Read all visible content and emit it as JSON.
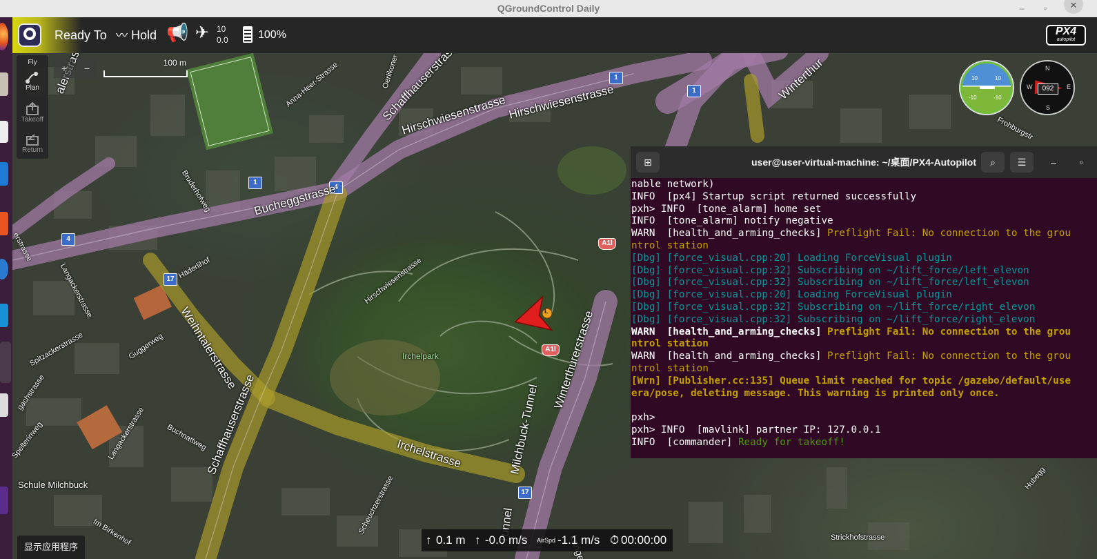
{
  "window": {
    "title": "QGroundControl Daily"
  },
  "toolbar": {
    "status": "Ready To",
    "flight_mode": "Hold",
    "gps_sats": "10",
    "gps_hdop": "0.0",
    "battery": "100%",
    "brand": "PX4",
    "brand_sub": "autopilot"
  },
  "flytools": {
    "fly": "Fly",
    "plan": "Plan",
    "takeoff": "Takeoff",
    "return": "Return"
  },
  "map": {
    "scale_label": "100 m",
    "zoom_in": "+",
    "zoom_out": "−",
    "labels": {
      "schaffhauserstrasse_top": "Schaffhauserstrasse",
      "hirschwiesen_1": "Hirschwiesenstrasse",
      "hirschwiesen_2": "Hirschwiesenstrasse",
      "hirschwiesen_park": "Hirschwiesenstrasse",
      "bucheggstrasse": "Bucheggstrasse",
      "winterthur_top": "Winterthur",
      "winterthurerstrasse": "Winterthurerstrasse",
      "weihntalerstrasse": "Weihntalerstrasse",
      "schaffhauserstrasse_bottom": "Schaffhauserstrasse",
      "irchelstrasse": "Irchelstrasse",
      "milchbuck_tunnel": "Milchbuck-Tunnel",
      "tunnel_bottom": "Tunnel",
      "irchelpark": "Irchelpark",
      "schule_milchbuck": "Schule Milchbuck",
      "anna_heer": "Anna-Heer-Strasse",
      "oerlikoner": "Oerlikoner",
      "bruderhofweg": "Bruderhofweg",
      "langackerstrasse": "Langackerstrasse",
      "langackerstrasse_2": "Langackerstrasse",
      "haderlihof": "Häderlihof",
      "spitzackerstrasse": "Spitzackerstrasse",
      "guggerweg": "Guggerweg",
      "buchnattweg": "Buchnattweg",
      "gachstrasse": "gachstrasse",
      "spelterinweg": "Spelterinweg",
      "im_birkenhof": "Im Birkenhof",
      "scheuchzerstrasse": "Scheuchzerstrasse",
      "frohburgstrasse": "Frohburgstr",
      "strickhofstrasse": "Strickhofstrasse",
      "hubegg": "Hubegg",
      "lange": "Lange",
      "erstrasse": "erstrasse",
      "alerstrasse": "alerstrasse"
    },
    "badges": {
      "b1a": "1",
      "b1b": "1",
      "b1c": "1",
      "b4a": "4",
      "b4b": "4",
      "b17a": "17",
      "b17b": "17",
      "a1": "A1l",
      "a2": "A1l"
    },
    "vehicle_label": "L"
  },
  "instruments": {
    "pitch_up": "10",
    "pitch_down": "-10",
    "compass_n": "N",
    "compass_e": "E",
    "compass_s": "S",
    "compass_w": "W",
    "heading": "092"
  },
  "terminal": {
    "title": "user@user-virtual-machine: ~/桌面/PX4-Autopilot",
    "lines": [
      {
        "p": "nable network)",
        "r": "",
        "k": ""
      },
      {
        "p": "INFO  [px4] Startup script returned successfully",
        "r": "",
        "k": ""
      },
      {
        "p": "pxh> INFO  [tone_alarm] home set",
        "r": "",
        "k": ""
      },
      {
        "p": "INFO  [tone_alarm] notify negative",
        "r": "",
        "k": ""
      },
      {
        "p": "WARN  [health_and_arming_checks] ",
        "r": "Preflight Fail: No connection to the grou",
        "k": "warn"
      },
      {
        "p": "",
        "r": "ntrol station",
        "k": "warn"
      },
      {
        "p": "",
        "r": "[Dbg] [force_visual.cpp:20] Loading ForceVisual plugin",
        "k": "dbg"
      },
      {
        "p": "",
        "r": "[Dbg] [force_visual.cpp:32] Subscribing on ~/lift_force/left_elevon",
        "k": "dbg"
      },
      {
        "p": "",
        "r": "[Dbg] [force_visual.cpp:32] Subscribing on ~/lift_force/left_elevon",
        "k": "dbg"
      },
      {
        "p": "",
        "r": "[Dbg] [force_visual.cpp:20] Loading ForceVisual plugin",
        "k": "dbg"
      },
      {
        "p": "",
        "r": "[Dbg] [force_visual.cpp:32] Subscribing on ~/lift_force/right_elevon",
        "k": "dbg"
      },
      {
        "p": "",
        "r": "[Dbg] [force_visual.cpp:32] Subscribing on ~/lift_force/right_elevon",
        "k": "dbg"
      },
      {
        "p": "WARN  [health_and_arming_checks] ",
        "r": "Preflight Fail: No connection to the grou",
        "k": "warnb"
      },
      {
        "p": "",
        "r": "ntrol station",
        "k": "warnb"
      },
      {
        "p": "WARN  [health_and_arming_checks] ",
        "r": "Preflight Fail: No connection to the grou",
        "k": "warn"
      },
      {
        "p": "",
        "r": "ntrol station",
        "k": "warn"
      },
      {
        "p": "",
        "r": "[Wrn] [Publisher.cc:135] Queue limit reached for topic /gazebo/default/use",
        "k": "warnb"
      },
      {
        "p": "",
        "r": "era/pose, deleting message. This warning is printed only once.",
        "k": "warnb"
      },
      {
        "p": "",
        "r": "",
        "k": ""
      },
      {
        "p": "pxh>",
        "r": "",
        "k": ""
      },
      {
        "p": "pxh> INFO  [mavlink] partner IP: 127.0.0.1",
        "r": "",
        "k": ""
      },
      {
        "p": "INFO  [commander] ",
        "r": "Ready for takeoff!",
        "k": "ok"
      }
    ]
  },
  "telemetry": {
    "altitude": "0.1 m",
    "vspeed": "-0.0 m/s",
    "airspeed_label": "AirSpd",
    "airspeed": "-1.1 m/s",
    "time": "00:00:00"
  },
  "tooltip": "显示应用程序"
}
